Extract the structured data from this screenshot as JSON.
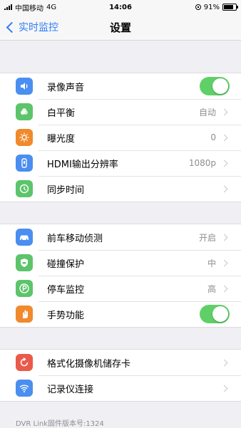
{
  "status_bar": {
    "carrier": "中国移动",
    "network": "4G",
    "time": "14:06",
    "battery": "91%",
    "battery_level": 0.91
  },
  "navbar": {
    "back_label": "实时监控",
    "title": "设置"
  },
  "groups": [
    {
      "items": [
        {
          "label": "录像声音",
          "control": "toggle",
          "on": true,
          "icon": "speaker-icon",
          "color": "#4a8ef0"
        },
        {
          "label": "白平衡",
          "value": "自动",
          "icon": "white-balance-icon",
          "color": "#5cc46a"
        },
        {
          "label": "曝光度",
          "value": "0",
          "icon": "sun-icon",
          "color": "#f08a2c"
        },
        {
          "label": "HDMI输出分辨率",
          "value": "1080p",
          "icon": "hdmi-icon",
          "color": "#4a8ef0"
        },
        {
          "label": "同步时间",
          "icon": "clock-icon",
          "color": "#5cc46a"
        }
      ]
    },
    {
      "items": [
        {
          "label": "前车移动侦测",
          "value": "开启",
          "icon": "car-icon",
          "color": "#4a8ef0"
        },
        {
          "label": "碰撞保护",
          "value": "中",
          "icon": "shield-car-icon",
          "color": "#5cc46a"
        },
        {
          "label": "停车监控",
          "value": "高",
          "icon": "parking-icon",
          "color": "#5cc46a"
        },
        {
          "label": "手势功能",
          "control": "toggle",
          "on": true,
          "icon": "hand-icon",
          "color": "#f08a2c"
        }
      ]
    },
    {
      "items": [
        {
          "label": "格式化摄像机储存卡",
          "icon": "format-icon",
          "color": "#ea5a4a"
        },
        {
          "label": "记录仪连接",
          "icon": "wifi-icon",
          "color": "#4a8ef0"
        }
      ]
    }
  ],
  "footer": {
    "version_text": "DVR Link固件版本号:1324"
  }
}
